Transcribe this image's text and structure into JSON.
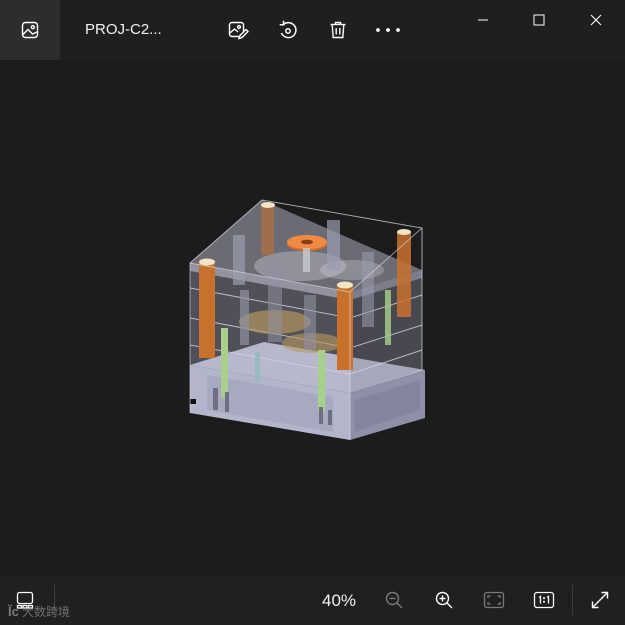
{
  "app": {
    "file_title": "PROJ-C2...",
    "zoom_level": "40%",
    "watermark_text": "大数跨境",
    "watermark_logo": "Ĭc"
  },
  "icons": {
    "app": "photo-icon",
    "edit": "edit-image-icon",
    "rotate": "rotate-icon",
    "delete": "delete-icon",
    "more": "more-icon",
    "minimize": "minimize-icon",
    "maximize": "maximize-icon",
    "close": "close-icon",
    "filmstrip": "filmstrip-icon",
    "zoom_out": "zoom-out-icon",
    "zoom_in": "zoom-in-icon",
    "fit": "fit-to-window-icon",
    "actual_size": "actual-size-icon",
    "fullscreen": "fullscreen-icon"
  },
  "colors": {
    "background": "#1c1c1c",
    "titlebar": "#1f1f1f",
    "app_button": "#2d2d2d",
    "icon": "#ffffff",
    "disabled_icon": "#7a7a7a"
  }
}
